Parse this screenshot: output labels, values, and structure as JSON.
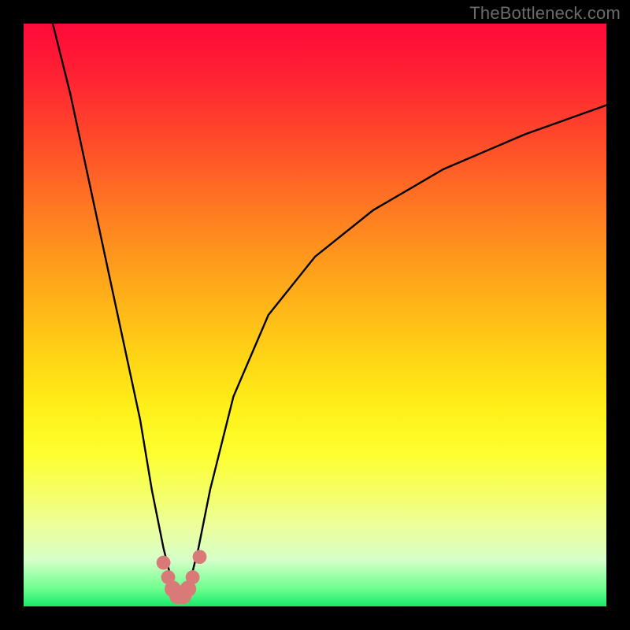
{
  "watermark": {
    "text": "TheBottleneck.com"
  },
  "chart_data": {
    "type": "line",
    "title": "",
    "xlabel": "",
    "ylabel": "",
    "xlim": [
      0,
      100
    ],
    "ylim": [
      0,
      100
    ],
    "grid": false,
    "background_gradient": {
      "direction": "vertical",
      "stops": [
        {
          "pos": 0.0,
          "color": "#ff0a3a"
        },
        {
          "pos": 0.2,
          "color": "#ff4a2a"
        },
        {
          "pos": 0.44,
          "color": "#ffa61a"
        },
        {
          "pos": 0.66,
          "color": "#fff019"
        },
        {
          "pos": 0.86,
          "color": "#edff9a"
        },
        {
          "pos": 1.0,
          "color": "#18e86b"
        }
      ]
    },
    "series": [
      {
        "name": "bottleneck-curve",
        "color": "#000000",
        "x": [
          5,
          8,
          11,
          14,
          17,
          20,
          22,
          24,
          25.5,
          26.5,
          27.5,
          28.5,
          30,
          32,
          36,
          42,
          50,
          60,
          72,
          86,
          100
        ],
        "y": [
          100,
          88,
          74,
          60,
          46,
          32,
          20,
          10,
          4,
          1.5,
          1.5,
          4,
          10,
          20,
          36,
          50,
          60,
          68,
          75,
          81,
          86
        ]
      }
    ],
    "markers": [
      {
        "name": "valley-marker",
        "shape": "circle",
        "color": "#d97a78",
        "cx": 24.0,
        "cy": 7.5,
        "r": 1.2
      },
      {
        "name": "valley-marker",
        "shape": "circle",
        "color": "#d97a78",
        "cx": 24.8,
        "cy": 5.0,
        "r": 1.2
      },
      {
        "name": "valley-marker",
        "shape": "circle",
        "color": "#d97a78",
        "cx": 25.6,
        "cy": 3.0,
        "r": 1.4
      },
      {
        "name": "valley-marker",
        "shape": "circle",
        "color": "#d97a78",
        "cx": 26.4,
        "cy": 1.8,
        "r": 1.4
      },
      {
        "name": "valley-marker",
        "shape": "circle",
        "color": "#d97a78",
        "cx": 27.4,
        "cy": 1.8,
        "r": 1.4
      },
      {
        "name": "valley-marker",
        "shape": "circle",
        "color": "#d97a78",
        "cx": 28.2,
        "cy": 3.0,
        "r": 1.4
      },
      {
        "name": "valley-marker",
        "shape": "circle",
        "color": "#d97a78",
        "cx": 29.0,
        "cy": 5.0,
        "r": 1.2
      },
      {
        "name": "valley-marker",
        "shape": "circle",
        "color": "#d97a78",
        "cx": 30.2,
        "cy": 8.5,
        "r": 1.2
      }
    ]
  }
}
